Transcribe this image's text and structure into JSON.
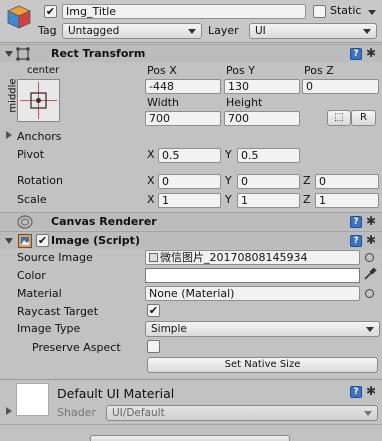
{
  "gameobject": {
    "name": "Img_Title",
    "active": true,
    "static_label": "Static",
    "tag_label": "Tag",
    "tag_value": "Untagged",
    "layer_label": "Layer",
    "layer_value": "UI"
  },
  "rect_transform": {
    "title": "Rect Transform",
    "anchor_preset_top": "center",
    "anchor_preset_side": "middle",
    "pos_x_label": "Pos X",
    "pos_y_label": "Pos Y",
    "pos_z_label": "Pos Z",
    "pos_x": "-448",
    "pos_y": "130",
    "pos_z": "0",
    "width_label": "Width",
    "height_label": "Height",
    "width": "700",
    "height": "700",
    "r_button": "R",
    "anchors_label": "Anchors",
    "pivot_label": "Pivot",
    "pivot_x": "0.5",
    "pivot_y": "0.5",
    "rotation_label": "Rotation",
    "rotation_x": "0",
    "rotation_y": "0",
    "rotation_z": "0",
    "scale_label": "Scale",
    "scale_x": "1",
    "scale_y": "1",
    "scale_z": "1",
    "x": "X",
    "y": "Y",
    "z": "Z"
  },
  "canvas_renderer": {
    "title": "Canvas Renderer"
  },
  "image": {
    "title": "Image (Script)",
    "enabled": true,
    "source_image_label": "Source Image",
    "source_image_value": "微信图片_20170808145934",
    "color_label": "Color",
    "color_value": "#ffffff",
    "material_label": "Material",
    "material_value": "None (Material)",
    "raycast_label": "Raycast Target",
    "raycast_checked": true,
    "image_type_label": "Image Type",
    "image_type_value": "Simple",
    "preserve_aspect_label": "Preserve Aspect",
    "preserve_aspect_checked": false,
    "set_native_size": "Set Native Size"
  },
  "material_preview": {
    "title": "Default UI Material",
    "shader_label": "Shader",
    "shader_value": "UI/Default"
  },
  "icons": [
    "gameobject-cube-icon",
    "rect-transform-icon",
    "canvas-renderer-icon",
    "image-component-icon",
    "help-icon",
    "gear-icon",
    "object-picker-icon",
    "eyedropper-icon"
  ]
}
